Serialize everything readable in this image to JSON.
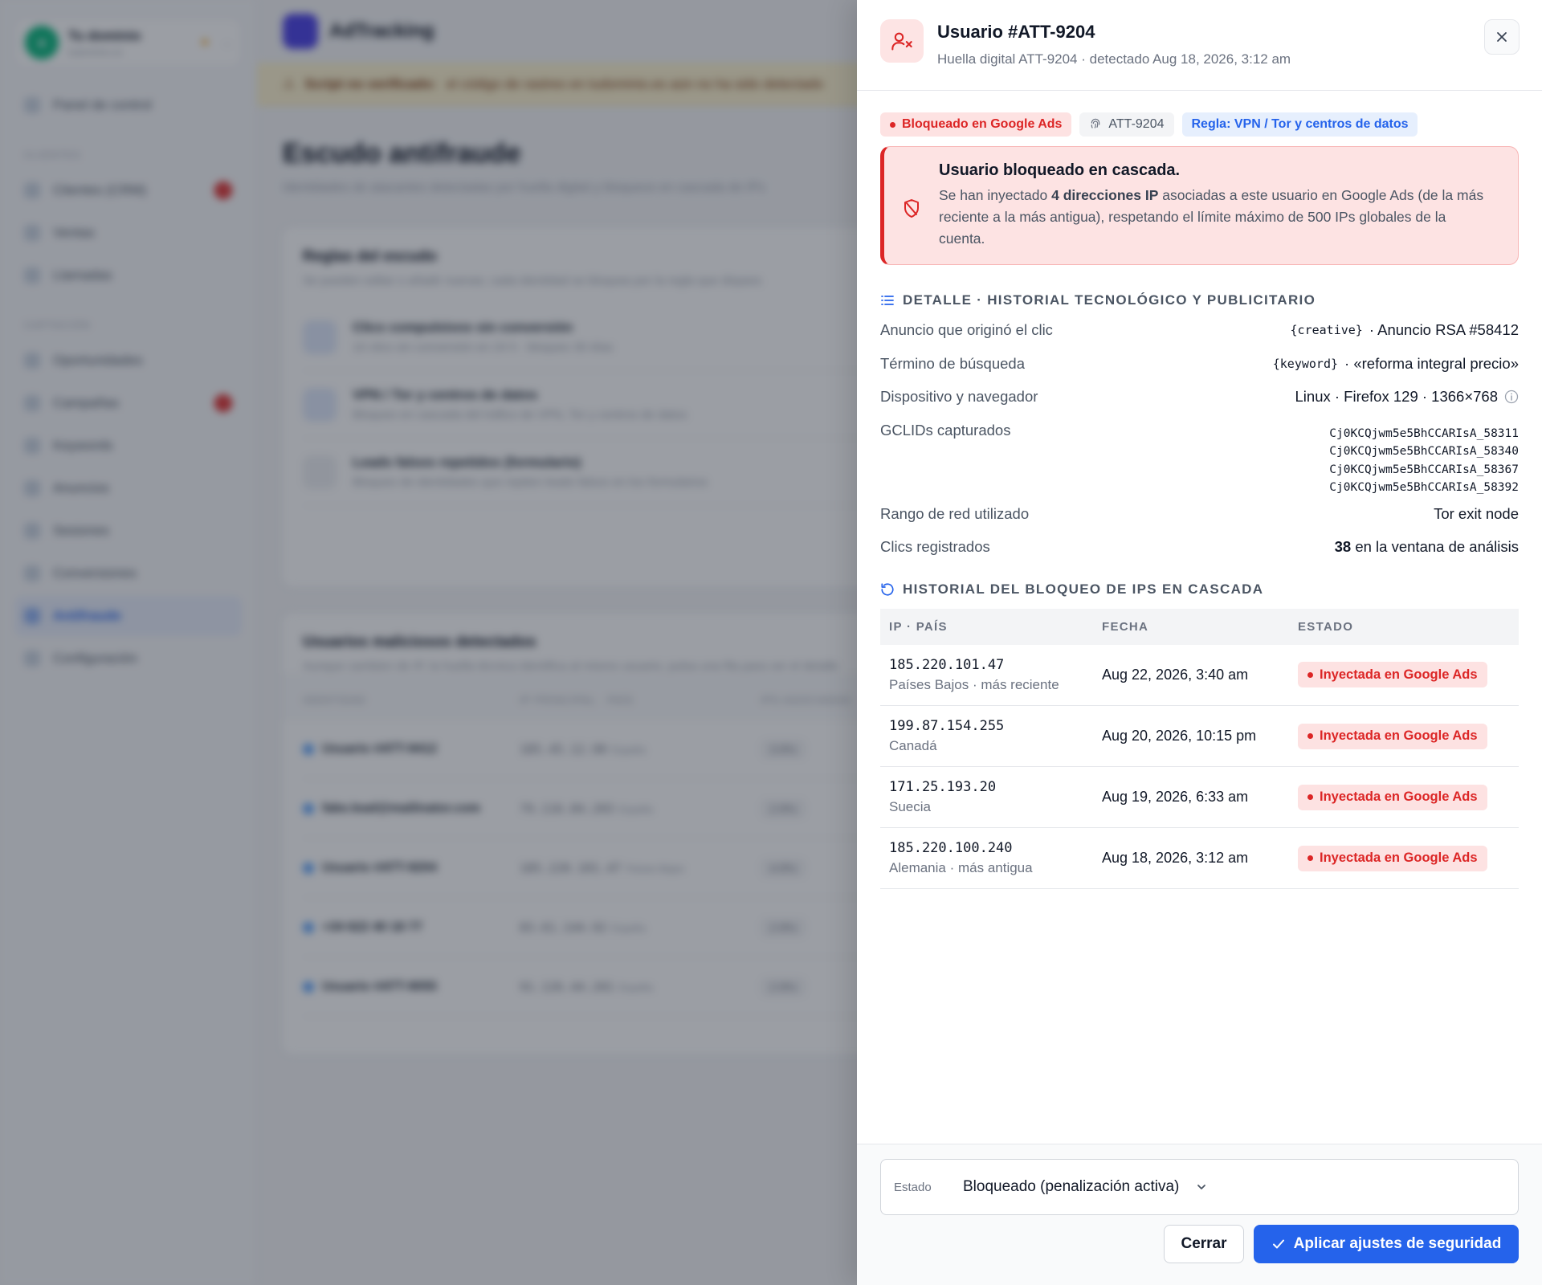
{
  "background": {
    "domain": {
      "name": "Tu dominio",
      "sub": "tudominio.es"
    },
    "nav_groups": {
      "clientes": "CLIENTES",
      "captacion": "CAPTACIÓN"
    },
    "nav": {
      "panel": "Panel de control",
      "crm": "Clientes (CRM)",
      "crm_badge": "4",
      "ventas": "Ventas",
      "llamadas": "Llamadas",
      "oportunidades": "Oportunidades",
      "campanas": "Campañas",
      "campanas_badge": "2",
      "keywords": "Keywords",
      "anuncios": "Anuncios",
      "sesiones": "Sesiones",
      "conversiones": "Conversiones",
      "antifraude": "Antifraude",
      "configuracion": "Configuración"
    },
    "brand": "AdTracking",
    "alert": {
      "strong": "Script no verificado:",
      "text": "el código de rastreo en tudominio.es aún no ha sido detectado"
    },
    "page": {
      "title": "Escudo antifraude",
      "description": "Identidades de atacantes detectadas por huella digital y bloqueos en cascada de IPs"
    },
    "rules_card": {
      "title": "Reglas del escudo",
      "description": "Se pueden editar o añadir nuevas; cada identidad se bloquea por la regla que dispara",
      "rules": [
        {
          "title": "Clics compulsivos sin conversión",
          "desc": "10 clics sin conversión en 24 h · bloqueo 30 días"
        },
        {
          "title": "VPN / Tor y centros de datos",
          "desc": "Bloqueo en cascada del tráfico de VPN, Tor y centros de datos"
        },
        {
          "title": "Leads falsos repetidos (formulario)",
          "desc": "Bloqueo de identidades que repiten leads falsos en los formularios"
        }
      ]
    },
    "users_card": {
      "title": "Usuarios maliciosos detectados",
      "description": "Aunque cambien de IP, la huella técnica identifica al mismo usuario; pulsa una fila para ver el detalle",
      "headers": {
        "identity": "IDENTIDAD",
        "ip": "IP PRINCIPAL · PAÍS",
        "ips": "IPS ASOCIADAS"
      },
      "rows": [
        {
          "id": "Usuario #ATT-9412",
          "ip": "185.45.12.90",
          "country": "España",
          "ips": "3 IPs"
        },
        {
          "id": "fake.lead@mailinator.com",
          "ip": "79.116.84.203",
          "country": "España",
          "ips": "2 IPs"
        },
        {
          "id": "Usuario #ATT-9204",
          "ip": "185.220.101.47",
          "country": "Países Bajos",
          "ips": "4 IPs"
        },
        {
          "id": "+34 622 40 18 77",
          "ip": "83.61.144.92",
          "country": "España",
          "ips": "2 IPs"
        },
        {
          "id": "Usuario #ATT-9055",
          "ip": "91.126.44.201",
          "country": "España",
          "ips": "2 IPs"
        }
      ]
    }
  },
  "drawer": {
    "title": "Usuario #ATT-9204",
    "subtitle": "Huella digital ATT-9204 · detectado Aug 18, 2026, 3:12 am",
    "chips": {
      "blocked": "Bloqueado en Google Ads",
      "fingerprint": "ATT-9204",
      "rule": "Regla: VPN / Tor y centros de datos"
    },
    "alert": {
      "title": "Usuario bloqueado en cascada.",
      "text_before": "Se han inyectado ",
      "text_bold": "4 direcciones IP",
      "text_after": " asociadas a este usuario en Google Ads (de la más reciente a la más antigua), respetando el límite máximo de 500 IPs globales de la cuenta."
    },
    "detail_section": "DETALLE · HISTORIAL TECNOLÓGICO Y PUBLICITARIO",
    "details": {
      "ad_label": "Anuncio que originó el clic",
      "ad_code": "{creative}",
      "ad_value": "· Anuncio RSA #58412",
      "term_label": "Término de búsqueda",
      "term_code": "{keyword}",
      "term_value": "· «reforma integral precio»",
      "device_label": "Dispositivo y navegador",
      "device_value": "Linux · Firefox 129 · 1366×768",
      "gclid_label": "GCLIDs capturados",
      "gclids": [
        "Cj0KCQjwm5e5BhCCARIsA_58311",
        "Cj0KCQjwm5e5BhCCARIsA_58340",
        "Cj0KCQjwm5e5BhCCARIsA_58367",
        "Cj0KCQjwm5e5BhCCARIsA_58392"
      ],
      "network_label": "Rango de red utilizado",
      "network_value": "Tor exit node",
      "clicks_label": "Clics registrados",
      "clicks_count": "38",
      "clicks_suffix": " en la ventana de análisis"
    },
    "history_section": "HISTORIAL DEL BLOQUEO DE IPS EN CASCADA",
    "table": {
      "headers": {
        "ip": "IP · PAÍS",
        "date": "FECHA",
        "status": "ESTADO"
      },
      "rows": [
        {
          "ip": "185.220.101.47",
          "country": "Países Bajos · más reciente",
          "date": "Aug 22, 2026, 3:40 am",
          "status": "Inyectada en Google Ads"
        },
        {
          "ip": "199.87.154.255",
          "country": "Canadá",
          "date": "Aug 20, 2026, 10:15 pm",
          "status": "Inyectada en Google Ads"
        },
        {
          "ip": "171.25.193.20",
          "country": "Suecia",
          "date": "Aug 19, 2026, 6:33 am",
          "status": "Inyectada en Google Ads"
        },
        {
          "ip": "185.220.100.240",
          "country": "Alemania · más antigua",
          "date": "Aug 18, 2026, 3:12 am",
          "status": "Inyectada en Google Ads"
        }
      ]
    },
    "footer": {
      "state_label": "Estado",
      "state_value": "Bloqueado (penalización activa)",
      "close_label": "Cerrar",
      "apply_label": "Aplicar ajustes de seguridad"
    }
  },
  "colors": {
    "danger": "#dc2626",
    "danger_bg": "#fde2e2",
    "primary": "#2563eb",
    "rule_chip_bg": "#e6effd"
  }
}
